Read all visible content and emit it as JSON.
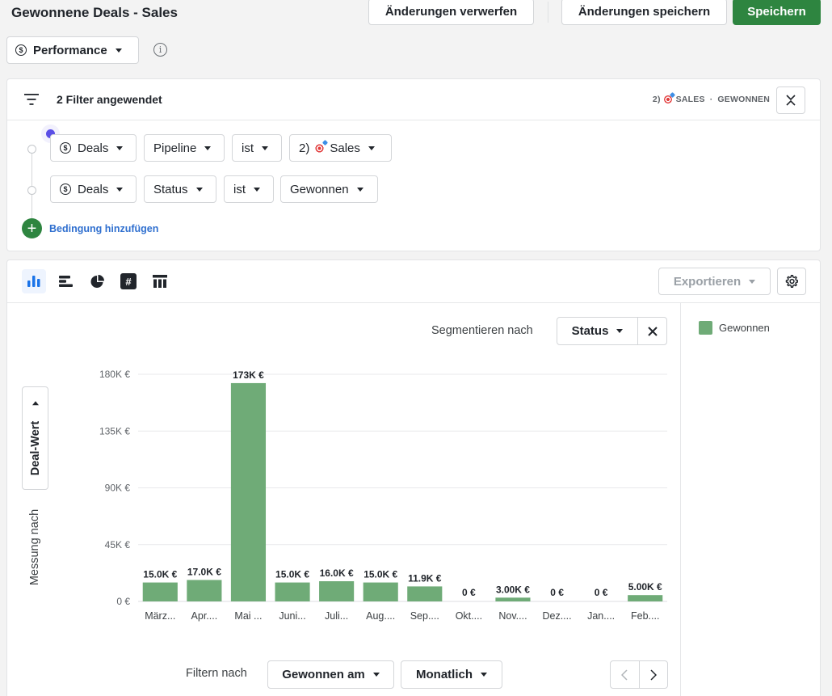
{
  "header": {
    "title": "Gewonnene Deals - Sales",
    "discard_label": "Änderungen verwerfen",
    "save_changes_label": "Änderungen speichern",
    "save_label": "Speichern"
  },
  "report_type": {
    "label": "Performance",
    "icon": "dollar-circle-icon"
  },
  "filters": {
    "title": "2 Filter angewendet",
    "summary_prefix": "2)",
    "summary_pipeline": "SALES",
    "summary_sep": "·",
    "summary_status": "GEWONNEN",
    "rows": [
      {
        "object": "Deals",
        "field": "Pipeline",
        "operator": "ist",
        "value_prefix": "2)",
        "value": "Sales"
      },
      {
        "object": "Deals",
        "field": "Status",
        "operator": "ist",
        "value": "Gewonnen"
      }
    ],
    "add_condition_label": "Bedingung hinzufügen"
  },
  "toolbar": {
    "chart_types": [
      "vertical-bar-chart-icon",
      "horizontal-bar-chart-icon",
      "pie-chart-icon",
      "number-icon",
      "table-icon"
    ],
    "active_chart_type": "vertical-bar-chart-icon",
    "export_label": "Exportieren"
  },
  "segment": {
    "label": "Segmentieren nach",
    "value": "Status"
  },
  "measure": {
    "label": "Messung nach",
    "value": "Deal-Wert"
  },
  "legend": [
    {
      "label": "Gewonnen",
      "color": "#6fab77"
    }
  ],
  "bottom": {
    "filter_label": "Filtern nach",
    "date_field": "Gewonnen am",
    "interval": "Monatlich"
  },
  "colors": {
    "accent_green": "#2e8540",
    "bar_green": "#6fab77",
    "link_blue": "#2f6fcf",
    "active_blue": "#1a73e8"
  },
  "chart_data": {
    "type": "bar",
    "title": "",
    "xlabel": "",
    "ylabel": "Deal-Wert",
    "categories": [
      "März...",
      "Apr....",
      "Mai ...",
      "Juni...",
      "Juli...",
      "Aug....",
      "Sep....",
      "Okt....",
      "Nov....",
      "Dez....",
      "Jan....",
      "Feb...."
    ],
    "series": [
      {
        "name": "Gewonnen",
        "values": [
          15000,
          17000,
          173000,
          15000,
          16000,
          15000,
          11900,
          0,
          3000,
          0,
          0,
          5000
        ],
        "labels": [
          "15.0K €",
          "17.0K €",
          "173K €",
          "15.0K €",
          "16.0K €",
          "15.0K €",
          "11.9K €",
          "0 €",
          "3.00K €",
          "0 €",
          "0 €",
          "5.00K €"
        ]
      }
    ],
    "ylim": [
      0,
      180000
    ],
    "yticks": [
      0,
      45000,
      90000,
      135000,
      180000
    ],
    "ytick_labels": [
      "0 €",
      "45K €",
      "90K €",
      "135K €",
      "180K €"
    ],
    "grid": true,
    "legend_position": "right"
  }
}
